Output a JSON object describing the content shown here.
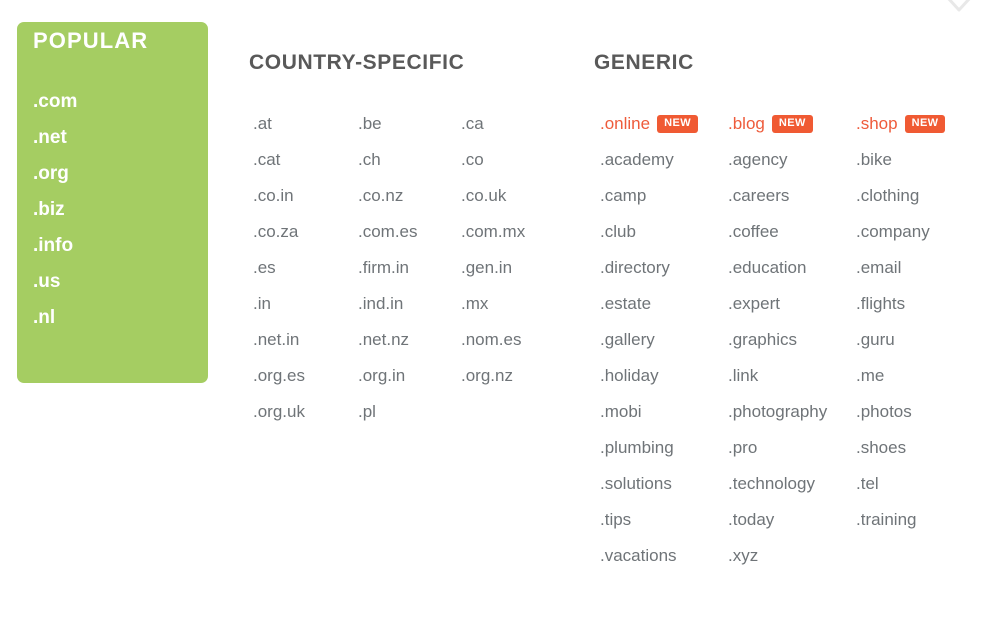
{
  "colors": {
    "panel_green": "#a5cd62",
    "accent_orange": "#f05a33",
    "link_orange": "#ee5b3b",
    "heading_gray": "#595959",
    "item_gray": "#6f7478",
    "white": "#ffffff"
  },
  "chevron": {
    "icon": "chevron-down-icon"
  },
  "popular": {
    "title": "POPULAR",
    "items": [
      {
        "label": ".com"
      },
      {
        "label": ".net"
      },
      {
        "label": ".org"
      },
      {
        "label": ".biz"
      },
      {
        "label": ".info"
      },
      {
        "label": ".us"
      },
      {
        "label": ".nl"
      }
    ]
  },
  "country_specific": {
    "title": "COUNTRY-SPECIFIC",
    "columns": [
      {
        "items": [
          {
            "label": ".at"
          },
          {
            "label": ".cat"
          },
          {
            "label": ".co.in"
          },
          {
            "label": ".co.za"
          },
          {
            "label": ".es"
          },
          {
            "label": ".in"
          },
          {
            "label": ".net.in"
          },
          {
            "label": ".org.es"
          },
          {
            "label": ".org.uk"
          }
        ]
      },
      {
        "items": [
          {
            "label": ".be"
          },
          {
            "label": ".ch"
          },
          {
            "label": ".co.nz"
          },
          {
            "label": ".com.es"
          },
          {
            "label": ".firm.in"
          },
          {
            "label": ".ind.in"
          },
          {
            "label": ".net.nz"
          },
          {
            "label": ".org.in"
          },
          {
            "label": ".pl"
          }
        ]
      },
      {
        "items": [
          {
            "label": ".ca"
          },
          {
            "label": ".co"
          },
          {
            "label": ".co.uk"
          },
          {
            "label": ".com.mx"
          },
          {
            "label": ".gen.in"
          },
          {
            "label": ".mx"
          },
          {
            "label": ".nom.es"
          },
          {
            "label": ".org.nz"
          }
        ]
      }
    ]
  },
  "generic": {
    "title": "GENERIC",
    "badge_label": "NEW",
    "columns": [
      {
        "items": [
          {
            "label": ".online",
            "badge": "NEW"
          },
          {
            "label": ".academy"
          },
          {
            "label": ".camp"
          },
          {
            "label": ".club"
          },
          {
            "label": ".directory"
          },
          {
            "label": ".estate"
          },
          {
            "label": ".gallery"
          },
          {
            "label": ".holiday"
          },
          {
            "label": ".mobi"
          },
          {
            "label": ".plumbing"
          },
          {
            "label": ".solutions"
          },
          {
            "label": ".tips"
          },
          {
            "label": ".vacations"
          }
        ]
      },
      {
        "items": [
          {
            "label": ".blog",
            "badge": "NEW"
          },
          {
            "label": ".agency"
          },
          {
            "label": ".careers"
          },
          {
            "label": ".coffee"
          },
          {
            "label": ".education"
          },
          {
            "label": ".expert"
          },
          {
            "label": ".graphics"
          },
          {
            "label": ".link"
          },
          {
            "label": ".photography"
          },
          {
            "label": ".pro"
          },
          {
            "label": ".technology"
          },
          {
            "label": ".today"
          },
          {
            "label": ".xyz"
          }
        ]
      },
      {
        "items": [
          {
            "label": ".shop",
            "badge": "NEW"
          },
          {
            "label": ".bike"
          },
          {
            "label": ".clothing"
          },
          {
            "label": ".company"
          },
          {
            "label": ".email"
          },
          {
            "label": ".flights"
          },
          {
            "label": ".guru"
          },
          {
            "label": ".me"
          },
          {
            "label": ".photos"
          },
          {
            "label": ".shoes"
          },
          {
            "label": ".tel"
          },
          {
            "label": ".training"
          }
        ]
      }
    ]
  }
}
